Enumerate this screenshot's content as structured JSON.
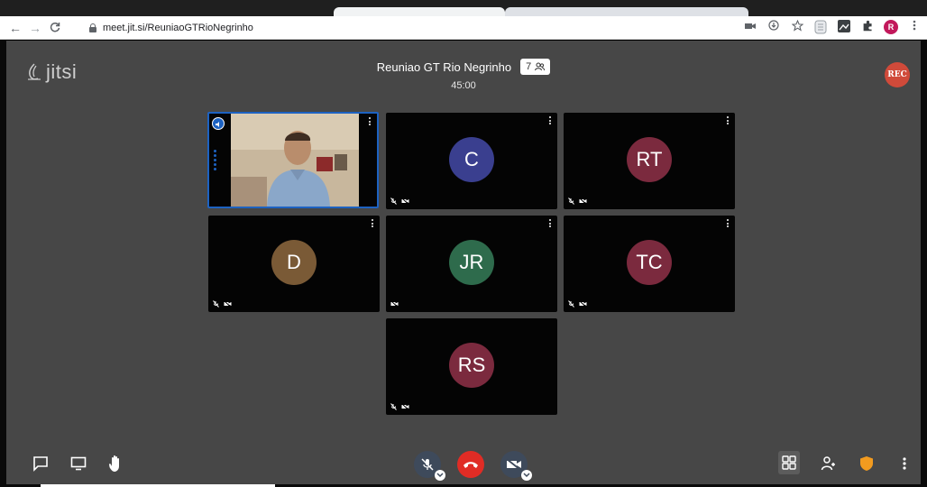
{
  "browser": {
    "url_host": "meet.jit.si",
    "url_path": "/ReuniaoGTRioNegrinho",
    "profile_initial": "R",
    "nav": {
      "back": "←",
      "forward": "→",
      "reload": "C"
    },
    "extension_icons": [
      "camera-icon",
      "install-icon",
      "star-icon",
      "reader-icon",
      "extension-puzzle-icon",
      "profile-avatar",
      "more-vert-icon"
    ]
  },
  "meeting": {
    "brand": "jitsi",
    "title": "Reuniao GT Rio Negrinho",
    "participants_count": "7",
    "timer": "45:00",
    "recording_badge": "REC"
  },
  "tiles": [
    {
      "kind": "video",
      "name": "speaker"
    },
    {
      "kind": "avatar",
      "initials": "C",
      "color": "#3a3f8f"
    },
    {
      "kind": "avatar",
      "initials": "RT",
      "color": "#7b2a3e"
    },
    {
      "kind": "avatar",
      "initials": "D",
      "color": "#7a5a36"
    },
    {
      "kind": "avatar",
      "initials": "JR",
      "color": "#2e6b4c"
    },
    {
      "kind": "avatar",
      "initials": "TC",
      "color": "#7b2a3e"
    },
    {
      "kind": "avatar",
      "initials": "RS",
      "color": "#7b2a3e"
    }
  ],
  "colors": {
    "stage": "#474747",
    "active_border": "#1d62c1",
    "hangup": "#e02c25",
    "security": "#f29b1f"
  }
}
